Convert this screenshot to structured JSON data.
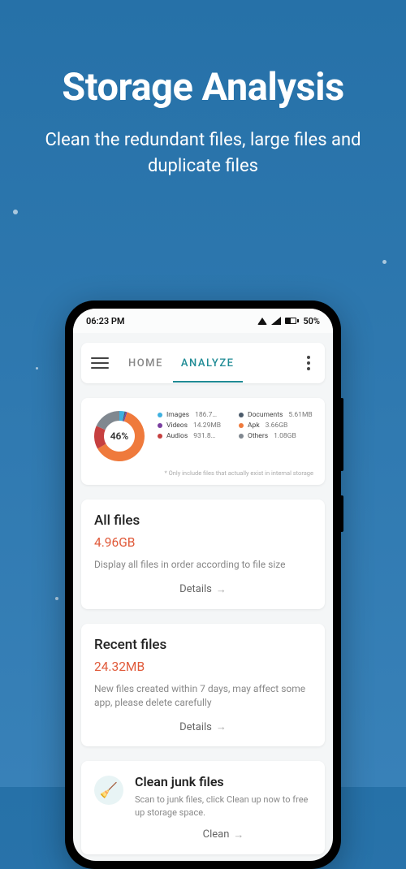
{
  "hero": {
    "title": "Storage Analysis",
    "subtitle": "Clean the redundant files, large files and duplicate files"
  },
  "statusbar": {
    "time": "06:23 PM",
    "battery_pct": "50%"
  },
  "tabs": {
    "home": "HOME",
    "analyze": "ANALYZE"
  },
  "chart_data": {
    "type": "pie",
    "title": "",
    "center_label": "46%",
    "series": [
      {
        "name": "Images",
        "value_label": "186.7…",
        "value_pct": 4,
        "color": "#3eb0e0"
      },
      {
        "name": "Documents",
        "value_label": "5.61MB",
        "value_pct": 1,
        "color": "#4a5a6a"
      },
      {
        "name": "Videos",
        "value_label": "14.29MB",
        "value_pct": 1,
        "color": "#7a3fa0"
      },
      {
        "name": "Apk",
        "value_label": "3.66GB",
        "value_pct": 74,
        "color": "#ef7a3c"
      },
      {
        "name": "Audios",
        "value_label": "931.8…",
        "value_pct": 18,
        "color": "#c64040"
      },
      {
        "name": "Others",
        "value_label": "1.08GB",
        "value_pct": 22,
        "color": "#808890"
      }
    ],
    "footnote": "* Only include files that actually exist in internal storage"
  },
  "all_files": {
    "title": "All files",
    "value": "4.96GB",
    "desc": "Display all files in order according to file size",
    "details": "Details"
  },
  "recent_files": {
    "title": "Recent files",
    "value": "24.32MB",
    "desc": "New files created within 7 days, may affect some app, please delete carefully",
    "details": "Details"
  },
  "clean": {
    "title": "Clean junk files",
    "desc": "Scan to junk files, click Clean up now to free up storage space.",
    "action": "Clean"
  }
}
